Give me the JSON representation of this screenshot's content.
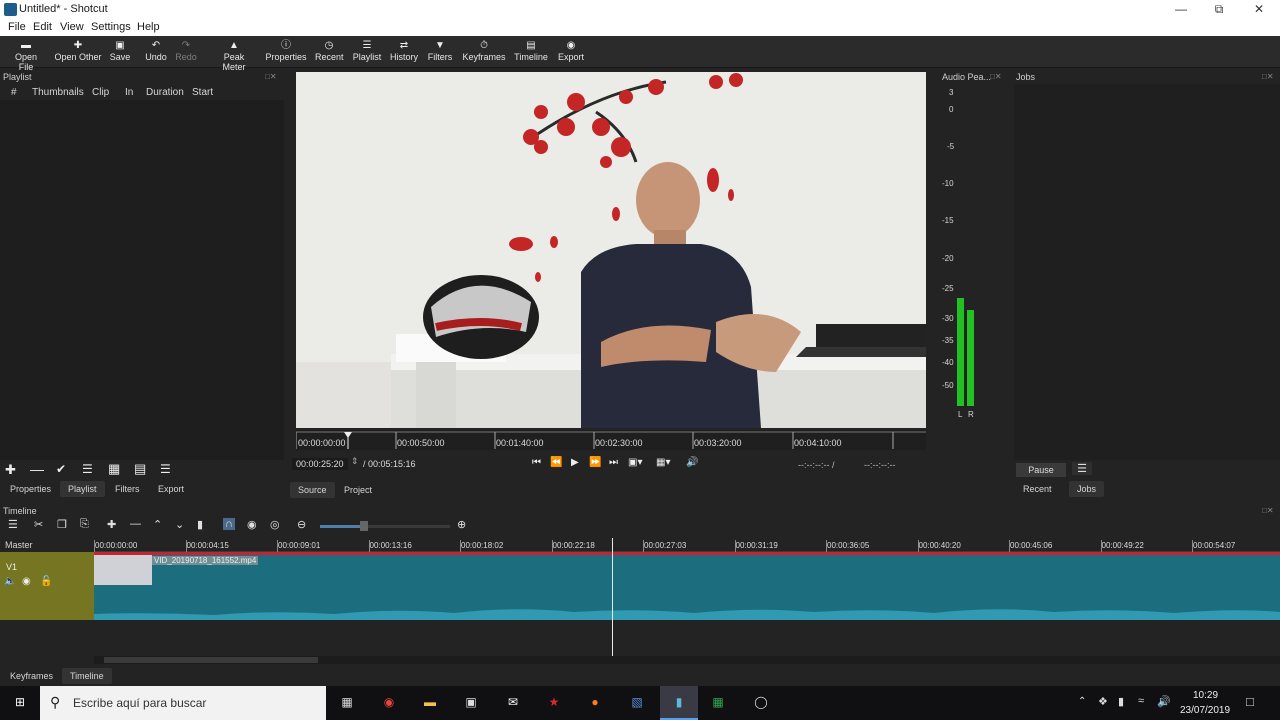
{
  "window": {
    "title": "Untitled* - Shotcut"
  },
  "menu": [
    "File",
    "Edit",
    "View",
    "Settings",
    "Help"
  ],
  "toolbar": [
    {
      "label": "Open File",
      "icon": "folder-icon"
    },
    {
      "label": "Open Other",
      "icon": "plus-icon"
    },
    {
      "label": "Save",
      "icon": "save-icon"
    },
    {
      "label": "Undo",
      "icon": "undo-icon"
    },
    {
      "label": "Redo",
      "icon": "redo-icon"
    },
    {
      "label": "Peak Meter",
      "icon": "meter-icon"
    },
    {
      "label": "Properties",
      "icon": "info-icon"
    },
    {
      "label": "Recent",
      "icon": "clock-icon"
    },
    {
      "label": "Playlist",
      "icon": "list-icon"
    },
    {
      "label": "History",
      "icon": "history-icon"
    },
    {
      "label": "Filters",
      "icon": "filter-icon"
    },
    {
      "label": "Keyframes",
      "icon": "stopwatch-icon"
    },
    {
      "label": "Timeline",
      "icon": "timeline-icon"
    },
    {
      "label": "Export",
      "icon": "export-icon"
    }
  ],
  "playlist": {
    "title": "Playlist",
    "columns": [
      "#",
      "Thumbnails",
      "Clip",
      "In",
      "Duration",
      "Start"
    ],
    "tabs": [
      "Properties",
      "Playlist",
      "Filters",
      "Export"
    ]
  },
  "player": {
    "ruler_ticks": [
      "00:00:00:00",
      "00:00:50:00",
      "00:01:40:00",
      "00:02:30:00",
      "00:03:20:00",
      "00:04:10:00"
    ],
    "current_time": "00:00:25:20",
    "total_time": "/ 00:05:15:16",
    "in_point": "--:--:--:-- /",
    "out_point": "--:--:--:--",
    "tabs": [
      "Source",
      "Project"
    ]
  },
  "audio_meter": {
    "title": "Audio Pea...",
    "scale": [
      "3",
      "0",
      "-5",
      "-10",
      "-15",
      "-20",
      "-25",
      "-30",
      "-35",
      "-40",
      "-50"
    ],
    "channels": [
      "L",
      "R"
    ],
    "level_left_db": -30,
    "level_right_db": -32
  },
  "jobs": {
    "title": "Jobs",
    "pause_label": "Pause",
    "tabs": [
      "Recent",
      "Jobs"
    ]
  },
  "timeline": {
    "title": "Timeline",
    "master_label": "Master",
    "track_label": "V1",
    "clip_name": "VID_20190718_161552.mp4",
    "ruler_ticks": [
      "00:00:00:00",
      "00:00:04:15",
      "00:00:09:01",
      "00:00:13:16",
      "00:00:18:02",
      "00:00:22:18",
      "00:00:27:03",
      "00:00:31:19",
      "00:00:36:05",
      "00:00:40:20",
      "00:00:45:06",
      "00:00:49:22",
      "00:00:54:07"
    ]
  },
  "bottom_tabs": [
    "Keyframes",
    "Timeline"
  ],
  "taskbar": {
    "search_placeholder": "Escribe aquí para buscar",
    "time": "10:29",
    "date": "23/07/2019"
  }
}
